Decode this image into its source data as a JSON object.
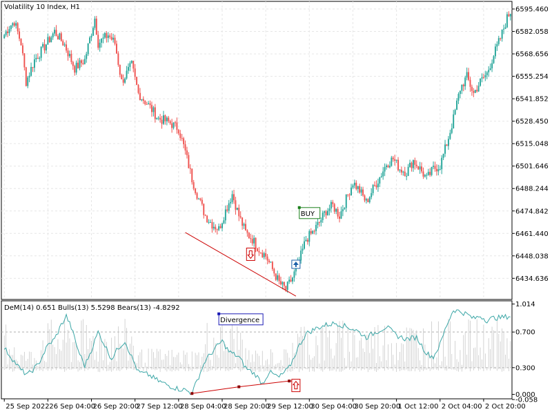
{
  "window": {
    "title": "Volatility 10 Index, H1"
  },
  "colors": {
    "bull": "#26a69a",
    "bear": "#ef5350",
    "grid": "#e6e6e6",
    "trendline": "#cc0000",
    "buy_label": "#1a7f1a",
    "divergence_label": "#1a1ab4",
    "dem_line": "#3aa6a6",
    "histogram": "#c8c8c8"
  },
  "chart_data": [
    {
      "type": "candlestick",
      "title": "Volatility 10 Index, H1",
      "ylim": [
        6422,
        6600
      ],
      "y_ticks": [
        "6595.460",
        "6582.058",
        "6568.656",
        "6555.254",
        "6541.852",
        "6528.450",
        "6515.048",
        "6501.646",
        "6488.244",
        "6474.842",
        "6461.440",
        "6448.038",
        "6434.636"
      ],
      "y_tick_values": [
        6595.46,
        6582.058,
        6568.656,
        6555.254,
        6541.852,
        6528.45,
        6515.048,
        6501.646,
        6488.244,
        6474.842,
        6461.44,
        6448.038,
        6434.636
      ],
      "price_anchors": [
        [
          0,
          6580
        ],
        [
          3,
          6585
        ],
        [
          6,
          6588
        ],
        [
          10,
          6575
        ],
        [
          13,
          6552
        ],
        [
          18,
          6565
        ],
        [
          24,
          6573
        ],
        [
          30,
          6582
        ],
        [
          36,
          6574
        ],
        [
          42,
          6560
        ],
        [
          48,
          6565
        ],
        [
          54,
          6590
        ],
        [
          56,
          6575
        ],
        [
          62,
          6580
        ],
        [
          66,
          6575
        ],
        [
          70,
          6552
        ],
        [
          76,
          6562
        ],
        [
          80,
          6545
        ],
        [
          86,
          6538
        ],
        [
          92,
          6530
        ],
        [
          98,
          6528
        ],
        [
          104,
          6524
        ],
        [
          108,
          6510
        ],
        [
          112,
          6494
        ],
        [
          116,
          6482
        ],
        [
          120,
          6472
        ],
        [
          124,
          6467
        ],
        [
          128,
          6464
        ],
        [
          132,
          6475
        ],
        [
          136,
          6485
        ],
        [
          140,
          6472
        ],
        [
          144,
          6462
        ],
        [
          148,
          6458
        ],
        [
          152,
          6452
        ],
        [
          156,
          6448
        ],
        [
          160,
          6440
        ],
        [
          164,
          6432
        ],
        [
          168,
          6428
        ],
        [
          172,
          6435
        ],
        [
          176,
          6445
        ],
        [
          180,
          6458
        ],
        [
          184,
          6462
        ],
        [
          188,
          6468
        ],
        [
          192,
          6475
        ],
        [
          196,
          6478
        ],
        [
          200,
          6472
        ],
        [
          204,
          6482
        ],
        [
          208,
          6492
        ],
        [
          212,
          6487
        ],
        [
          216,
          6480
        ],
        [
          220,
          6488
        ],
        [
          224,
          6495
        ],
        [
          228,
          6503
        ],
        [
          232,
          6506
        ],
        [
          236,
          6500
        ],
        [
          240,
          6498
        ],
        [
          244,
          6505
        ],
        [
          248,
          6500
        ],
        [
          252,
          6494
        ],
        [
          256,
          6500
        ],
        [
          260,
          6502
        ],
        [
          264,
          6515
        ],
        [
          268,
          6530
        ],
        [
          272,
          6548
        ],
        [
          276,
          6555
        ],
        [
          280,
          6545
        ],
        [
          284,
          6552
        ],
        [
          288,
          6557
        ],
        [
          292,
          6568
        ],
        [
          296,
          6578
        ],
        [
          300,
          6590
        ],
        [
          302,
          6594
        ]
      ],
      "annotations": {
        "buy_label": "BUY",
        "buy_at": {
          "bar": 176,
          "price": 6474
        },
        "down_arrow_at": {
          "bar": 147,
          "price": 6449
        },
        "up_arrow_at": {
          "bar": 174,
          "price": 6443
        },
        "trendline": {
          "from": {
            "bar": 108,
            "price": 6462
          },
          "to": {
            "bar": 174,
            "price": 6424
          }
        }
      }
    },
    {
      "type": "line",
      "title": "DeM(14) 0.651 Bulls(13) 5.5298 Bears(13) -4.8292",
      "series": [
        {
          "name": "DeM(14)",
          "values": []
        }
      ],
      "ylim": [
        -0.05,
        1.05
      ],
      "y_ticks": [
        "1.014",
        "0.700",
        "0.300",
        "0.000",
        "-0.058"
      ],
      "y_tick_values": [
        1.014,
        0.7,
        0.3,
        0.0,
        -0.058
      ],
      "dem_anchors": [
        [
          0,
          0.52
        ],
        [
          4,
          0.42
        ],
        [
          10,
          0.27
        ],
        [
          14,
          0.22
        ],
        [
          20,
          0.33
        ],
        [
          26,
          0.55
        ],
        [
          30,
          0.62
        ],
        [
          34,
          0.78
        ],
        [
          37,
          0.88
        ],
        [
          40,
          0.75
        ],
        [
          44,
          0.5
        ],
        [
          48,
          0.32
        ],
        [
          52,
          0.5
        ],
        [
          56,
          0.7
        ],
        [
          60,
          0.55
        ],
        [
          64,
          0.4
        ],
        [
          68,
          0.52
        ],
        [
          72,
          0.6
        ],
        [
          76,
          0.42
        ],
        [
          80,
          0.25
        ],
        [
          86,
          0.22
        ],
        [
          92,
          0.15
        ],
        [
          98,
          0.1
        ],
        [
          104,
          0.06
        ],
        [
          108,
          0.05
        ],
        [
          112,
          0.01
        ],
        [
          116,
          0.2
        ],
        [
          120,
          0.38
        ],
        [
          126,
          0.52
        ],
        [
          130,
          0.6
        ],
        [
          134,
          0.48
        ],
        [
          140,
          0.42
        ],
        [
          144,
          0.3
        ],
        [
          150,
          0.22
        ],
        [
          154,
          0.12
        ],
        [
          158,
          0.25
        ],
        [
          164,
          0.19
        ],
        [
          170,
          0.3
        ],
        [
          176,
          0.55
        ],
        [
          180,
          0.68
        ],
        [
          186,
          0.74
        ],
        [
          192,
          0.78
        ],
        [
          198,
          0.8
        ],
        [
          204,
          0.76
        ],
        [
          210,
          0.72
        ],
        [
          216,
          0.64
        ],
        [
          222,
          0.7
        ],
        [
          228,
          0.76
        ],
        [
          234,
          0.66
        ],
        [
          240,
          0.62
        ],
        [
          246,
          0.64
        ],
        [
          252,
          0.46
        ],
        [
          256,
          0.42
        ],
        [
          260,
          0.56
        ],
        [
          264,
          0.78
        ],
        [
          268,
          0.95
        ],
        [
          272,
          0.93
        ],
        [
          276,
          0.9
        ],
        [
          280,
          0.85
        ],
        [
          284,
          0.88
        ],
        [
          288,
          0.83
        ],
        [
          292,
          0.86
        ],
        [
          296,
          0.86
        ],
        [
          302,
          0.88
        ]
      ],
      "annotations": {
        "divergence_label": "Divergence",
        "divergence_label_at": {
          "bar": 128,
          "value": 0.85
        },
        "divergence_line": [
          {
            "bar": 112,
            "value": 0.01
          },
          {
            "bar": 140,
            "value": 0.085
          },
          {
            "bar": 170,
            "value": 0.15
          },
          {
            "bar": 175,
            "value": 0.15
          }
        ],
        "up_arrow_at": {
          "bar": 174,
          "value": 0.1
        }
      }
    }
  ],
  "x_axis": {
    "bars_total": 303,
    "labels": [
      {
        "text": "25 Sep 2022",
        "bar": 0
      },
      {
        "text": "26 Sep 04:00",
        "bar": 26
      },
      {
        "text": "26 Sep 20:00",
        "bar": 52
      },
      {
        "text": "27 Sep 12:00",
        "bar": 78
      },
      {
        "text": "28 Sep 04:00",
        "bar": 104
      },
      {
        "text": "28 Sep 20:00",
        "bar": 130
      },
      {
        "text": "29 Sep 12:00",
        "bar": 156
      },
      {
        "text": "30 Sep 04:00",
        "bar": 182
      },
      {
        "text": "30 Sep 20:00",
        "bar": 208
      },
      {
        "text": "1 Oct 12:00",
        "bar": 234
      },
      {
        "text": "2 Oct 04:00",
        "bar": 260
      },
      {
        "text": "2 Oct 20:00",
        "bar": 286
      }
    ]
  }
}
